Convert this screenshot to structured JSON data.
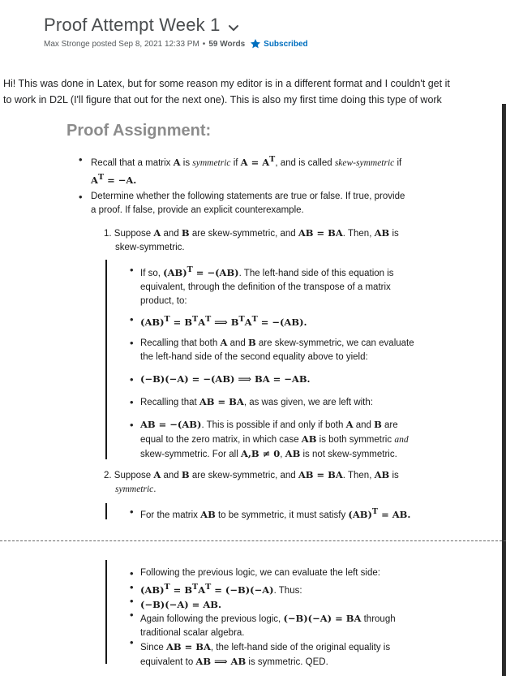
{
  "header": {
    "title": "Proof Attempt Week 1",
    "author_line": "Max Stronge posted Sep 8, 2021 12:33 PM",
    "separator": "•",
    "word_count": "59 Words",
    "subscribed_label": "Subscribed"
  },
  "intro": {
    "line1": "Hi! This was done in Latex, but for some reason my editor is in a different format and I couldn't get it",
    "line2": "to work in D2L (I'll figure that out for the next one). This is also my first time doing this type of work"
  },
  "doc": {
    "title": "Proof Assignment:",
    "bullet_symbol": "•",
    "b1": {
      "p1": "Recall that a matrix ",
      "m1": "A",
      "p2": " is ",
      "i1": "symmetric",
      "p3": " if ",
      "m2": "A = A",
      "s1": "T",
      "p4": ", and is called ",
      "i2": "skew-symmetric",
      "p5": " if",
      "m3": "A",
      "s2": "T",
      "m4": " = −A."
    },
    "b2": {
      "line1": "Determine whether the following statements are true or false. If true, provide",
      "line2": "a proof. If false, provide an explicit counterexample."
    },
    "item1": {
      "num": "1.",
      "p1": "Suppose ",
      "m1": "A",
      "p2": " and ",
      "m2": "B",
      "p3": " are skew-symmetric, and ",
      "m3": "AB = BA",
      "p4": ". Then, ",
      "m4": "AB",
      "p5": " is",
      "line2": "skew-symmetric."
    },
    "sub1": {
      "p1": "If so, ",
      "m1": "(AB)",
      "s1": "T",
      "m2": " = −(AB)",
      "p2": ". The left-hand side of this equation is",
      "line2": "equivalent, through the definition of the transpose of a matrix",
      "line3": "product, to:"
    },
    "sub2": {
      "m1": "(AB)",
      "s1": "T",
      "m2": " = B",
      "s2": "T",
      "m3": "A",
      "s3": "T",
      "m4": " ⟹ B",
      "s4": "T",
      "m5": "A",
      "s5": "T",
      "m6": " = −(AB)."
    },
    "sub3": {
      "p1": "Recalling that both ",
      "m1": "A",
      "p2": " and ",
      "m2": "B",
      "p3": " are skew-symmetric, we can evaluate",
      "line2": "the left-hand side of the second equality above to yield:"
    },
    "sub4": {
      "m1": "(−B)(−A) = −(AB) ⟹ BA = −AB."
    },
    "sub5": {
      "p1": "Recalling that ",
      "m1": "AB = BA",
      "p2": ", as was given, we are left with:"
    },
    "sub6": {
      "m1": "AB = −(AB)",
      "p1": ". This is possible if and only if both ",
      "m2": "A",
      "p2": " and ",
      "m3": "B",
      "p3": " are",
      "l2p1": "equal to the zero matrix, in which case ",
      "l2m1": "AB",
      "l2p2": " is both symmetric ",
      "l2i1": "and",
      "l3p1": "skew-symmetric. For all ",
      "l3m1": "A,B ≠ 0",
      "l3p2": ", ",
      "l3m2": "AB",
      "l3p3": " is not skew-symmetric."
    },
    "item2": {
      "num": "2.",
      "p1": "Suppose ",
      "m1": "A",
      "p2": " and ",
      "m2": "B",
      "p3": " are skew-symmetric, and ",
      "m3": "AB = BA",
      "p4": ". Then, ",
      "m4": "AB",
      "p5": " is",
      "i1": "symmetric",
      "p6": "."
    },
    "sub7": {
      "p1": "For the matrix ",
      "m1": "AB",
      "p2": " to be symmetric, it must satisfy ",
      "m2": "(AB)",
      "s1": "T",
      "m3": " = AB."
    },
    "cont": {
      "l1": "Following the previous logic, we can evaluate the left side:",
      "l2m1": "(AB)",
      "l2s1": "T",
      "l2m2": " = B",
      "l2s2": "T",
      "l2m3": "A",
      "l2s3": "T",
      "l2m4": " = (−B)(−A)",
      "l2p1": ". Thus:",
      "l3m1": "(−B)(−A) = AB.",
      "l4p1": "Again following the previous logic, ",
      "l4m1": "(−B)(−A) = BA",
      "l4p2": " through",
      "l5": "traditional scalar algebra.",
      "l6p1": "Since ",
      "l6m1": "AB = BA",
      "l6p2": ", the left-hand side of the original equality is",
      "l7p1": "equivalent to ",
      "l7m1": "AB ⟹ AB",
      "l7p2": " is symmetric. QED."
    }
  }
}
